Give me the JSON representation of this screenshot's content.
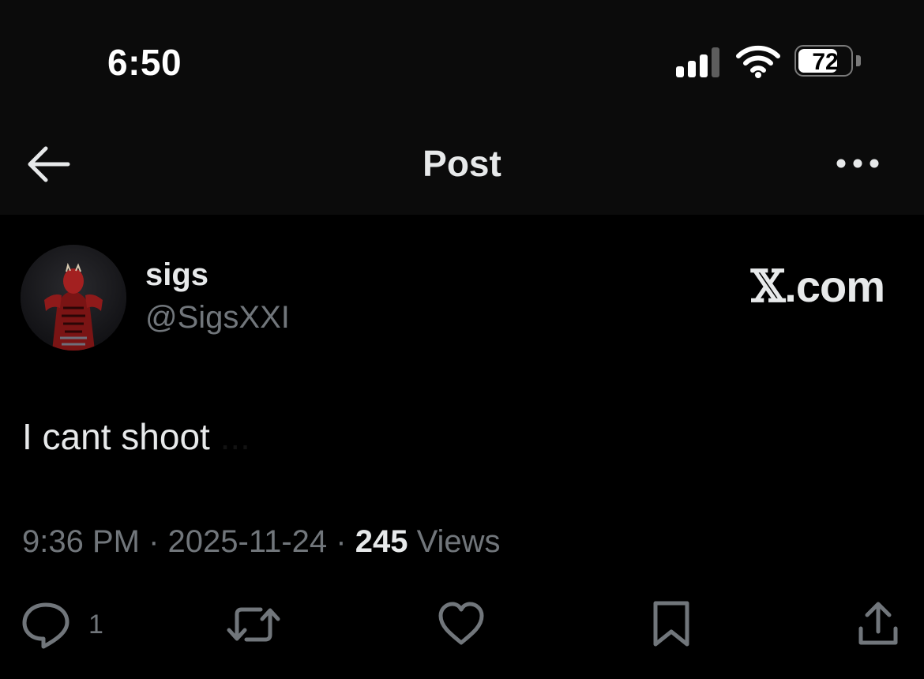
{
  "status_bar": {
    "time": "6:50",
    "battery_level": "72",
    "battery_fraction": 0.72,
    "signal_bars_active": 3,
    "signal_bars_total": 4
  },
  "nav": {
    "title": "Post",
    "back_icon": "arrow-left-icon",
    "more_icon": "more-horizontal-icon"
  },
  "post": {
    "author": {
      "name": "sigs",
      "handle": "@SigsXXI"
    },
    "watermark": {
      "mark": "𝕏",
      "text": ".com"
    },
    "text_visible": "I cant shoot",
    "text_faded": " ...",
    "meta": {
      "time": "9:36 PM",
      "sep1": " · ",
      "date": "2025-11-24",
      "sep2": " · ",
      "views_count": "245",
      "views_label": " Views"
    },
    "actions": {
      "reply_count": "1",
      "reply_icon": "reply-icon",
      "repost_icon": "repost-icon",
      "like_icon": "heart-icon",
      "bookmark_icon": "bookmark-icon",
      "share_icon": "share-icon"
    }
  },
  "colors": {
    "background": "#000000",
    "header_background": "#0b0b0b",
    "primary_text": "#e7e9ea",
    "secondary_text": "#71767b"
  }
}
